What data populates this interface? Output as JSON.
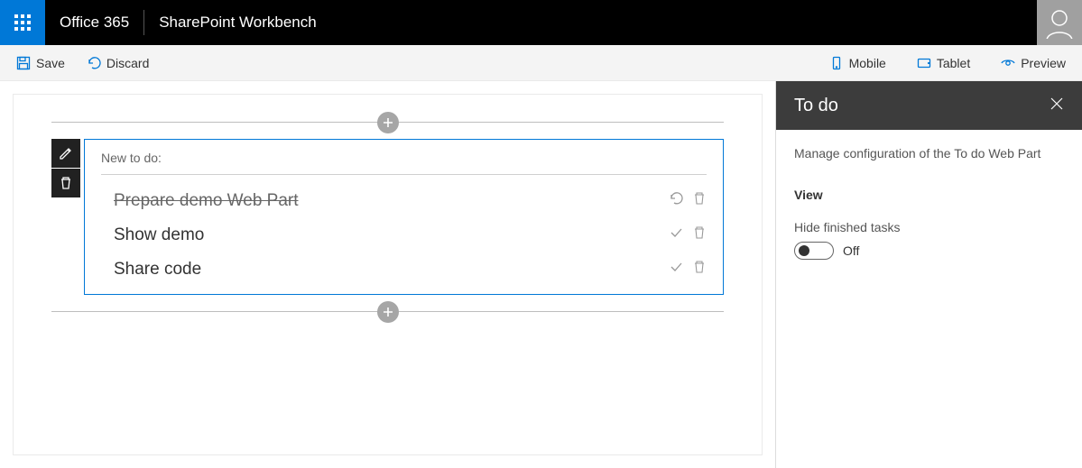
{
  "header": {
    "brand": "Office 365",
    "app_title": "SharePoint Workbench"
  },
  "commandbar": {
    "save": "Save",
    "discard": "Discard",
    "mobile": "Mobile",
    "tablet": "Tablet",
    "preview": "Preview"
  },
  "webpart": {
    "new_todo_placeholder": "New to do:",
    "items": [
      {
        "text": "Prepare demo Web Part",
        "done": true
      },
      {
        "text": "Show demo",
        "done": false
      },
      {
        "text": "Share code",
        "done": false
      }
    ]
  },
  "pane": {
    "title": "To do",
    "description": "Manage configuration of the To do Web Part",
    "section": "View",
    "hide_finished_label": "Hide finished tasks",
    "toggle_state": "Off"
  }
}
